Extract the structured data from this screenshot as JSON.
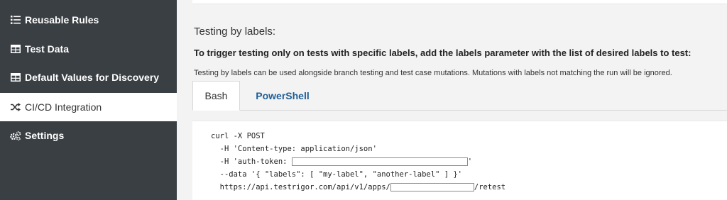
{
  "sidebar": {
    "items": [
      {
        "label": "Reusable Rules",
        "icon": "list-icon"
      },
      {
        "label": "Test Data",
        "icon": "table-icon"
      },
      {
        "label": "Default Values for Discovery",
        "icon": "table-icon"
      },
      {
        "label": "CI/CD Integration",
        "icon": "shuffle-icon",
        "active": true
      },
      {
        "label": "Settings",
        "icon": "gears-icon"
      }
    ]
  },
  "main": {
    "heading": "Testing by labels:",
    "instruction": "To trigger testing only on tests with specific labels, add the labels parameter with the list of desired labels to test:",
    "note": "Testing by labels can be used alongside branch testing and test case mutations. Mutations with labels not matching the run will be ignored.",
    "tabs": [
      {
        "label": "Bash",
        "active": true
      },
      {
        "label": "PowerShell",
        "active": false
      }
    ],
    "code": {
      "line1": "curl -X POST",
      "line2": "  -H 'Content-type: application/json'",
      "line3_prefix": "  -H 'auth-token: ",
      "line3_suffix": "'",
      "line4": "  --data '{ \"labels\": [ \"my-label\", \"another-label\" ] }'",
      "line5_prefix": "  https://api.testrigor.com/api/v1/apps/",
      "line5_suffix": "/retest"
    }
  },
  "colors": {
    "sidebar_bg": "#3a3f44",
    "link_blue": "#1f5f96"
  }
}
